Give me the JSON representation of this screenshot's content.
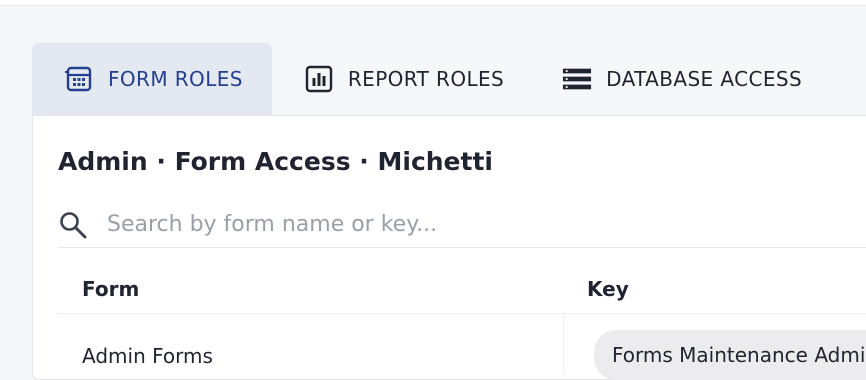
{
  "tabs": [
    {
      "label": "FORM ROLES",
      "icon": "calculator-icon",
      "active": true
    },
    {
      "label": "REPORT ROLES",
      "icon": "bar-chart-icon",
      "active": false
    },
    {
      "label": "DATABASE ACCESS",
      "icon": "database-list-icon",
      "active": false
    }
  ],
  "colors": {
    "accent": "#243f8f",
    "active_tab_bg": "#e3e8f1",
    "pill_bg": "#ececee"
  },
  "page": {
    "title": "Admin · Form Access · Michetti"
  },
  "search": {
    "placeholder": "Search by form name or key..."
  },
  "table": {
    "columns": [
      "Form",
      "Key"
    ],
    "rows": [
      {
        "form": "Admin Forms",
        "key": "Forms Maintenance Admin"
      }
    ]
  }
}
